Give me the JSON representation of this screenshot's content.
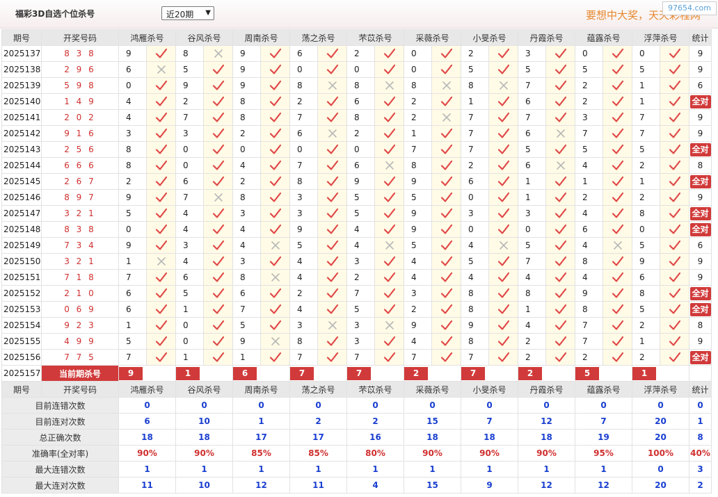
{
  "header": {
    "title": "福彩3D自选个位杀号",
    "period_select": "近20期",
    "slogan": "要想中大奖，天天彩程网",
    "watermark": "97654.com"
  },
  "columns": {
    "qihao": "期号",
    "draw": "开奖号码",
    "experts": [
      "鸿雁杀号",
      "谷风杀号",
      "周南杀号",
      "荡之杀号",
      "芣苡杀号",
      "采薇杀号",
      "小旻杀号",
      "丹霞杀号",
      "蕴露杀号",
      "浮萍杀号"
    ],
    "stat": "统计"
  },
  "rows": [
    {
      "q": "2025137",
      "d": "8 3 8",
      "k": [
        9,
        8,
        9,
        6,
        2,
        0,
        2,
        3,
        0,
        0
      ],
      "r": [
        1,
        0,
        1,
        1,
        1,
        1,
        1,
        1,
        1,
        1
      ],
      "s": "9"
    },
    {
      "q": "2025138",
      "d": "2 9 6",
      "k": [
        6,
        5,
        9,
        0,
        0,
        0,
        5,
        5,
        5,
        5
      ],
      "r": [
        0,
        1,
        1,
        1,
        1,
        1,
        1,
        1,
        1,
        1
      ],
      "s": "9"
    },
    {
      "q": "2025139",
      "d": "5 9 8",
      "k": [
        0,
        9,
        9,
        8,
        8,
        8,
        8,
        7,
        2,
        1
      ],
      "r": [
        1,
        1,
        1,
        0,
        0,
        0,
        0,
        1,
        1,
        1
      ],
      "s": "6"
    },
    {
      "q": "2025140",
      "d": "1 4 9",
      "k": [
        4,
        2,
        8,
        2,
        6,
        2,
        1,
        6,
        2,
        1
      ],
      "r": [
        1,
        1,
        1,
        1,
        1,
        1,
        1,
        1,
        1,
        1
      ],
      "s": "全对"
    },
    {
      "q": "2025141",
      "d": "2 0 2",
      "k": [
        4,
        7,
        8,
        7,
        8,
        2,
        7,
        7,
        3,
        7
      ],
      "r": [
        1,
        1,
        1,
        1,
        1,
        0,
        1,
        1,
        1,
        1
      ],
      "s": "9"
    },
    {
      "q": "2025142",
      "d": "9 1 6",
      "k": [
        3,
        3,
        2,
        6,
        2,
        1,
        7,
        6,
        7,
        7
      ],
      "r": [
        1,
        1,
        1,
        0,
        1,
        1,
        1,
        0,
        1,
        1
      ],
      "s": "9"
    },
    {
      "q": "2025143",
      "d": "2 5 6",
      "k": [
        8,
        0,
        0,
        0,
        0,
        7,
        7,
        5,
        5,
        5
      ],
      "r": [
        1,
        1,
        1,
        1,
        1,
        1,
        1,
        1,
        1,
        1
      ],
      "s": "全对"
    },
    {
      "q": "2025144",
      "d": "6 6 6",
      "k": [
        8,
        0,
        4,
        7,
        6,
        8,
        2,
        6,
        4,
        2
      ],
      "r": [
        1,
        1,
        1,
        1,
        0,
        1,
        1,
        0,
        1,
        1
      ],
      "s": "8"
    },
    {
      "q": "2025145",
      "d": "2 6 7",
      "k": [
        2,
        6,
        2,
        8,
        9,
        9,
        6,
        1,
        1,
        1
      ],
      "r": [
        1,
        1,
        1,
        1,
        1,
        1,
        1,
        1,
        1,
        1
      ],
      "s": "全对"
    },
    {
      "q": "2025146",
      "d": "8 9 7",
      "k": [
        9,
        7,
        8,
        3,
        5,
        5,
        0,
        1,
        2,
        2
      ],
      "r": [
        1,
        0,
        1,
        1,
        1,
        1,
        1,
        1,
        1,
        1
      ],
      "s": "9"
    },
    {
      "q": "2025147",
      "d": "3 2 1",
      "k": [
        5,
        4,
        3,
        3,
        5,
        9,
        3,
        3,
        4,
        8
      ],
      "r": [
        1,
        1,
        1,
        1,
        1,
        1,
        1,
        1,
        1,
        1
      ],
      "s": "全对"
    },
    {
      "q": "2025148",
      "d": "8 3 8",
      "k": [
        0,
        4,
        4,
        9,
        4,
        9,
        0,
        0,
        6,
        0
      ],
      "r": [
        1,
        1,
        1,
        1,
        1,
        1,
        1,
        1,
        1,
        1
      ],
      "s": "全对"
    },
    {
      "q": "2025149",
      "d": "7 3 4",
      "k": [
        9,
        3,
        4,
        5,
        4,
        5,
        4,
        5,
        4,
        5
      ],
      "r": [
        1,
        1,
        0,
        1,
        0,
        1,
        0,
        1,
        0,
        1
      ],
      "s": "6"
    },
    {
      "q": "2025150",
      "d": "3 2 1",
      "k": [
        1,
        4,
        3,
        4,
        3,
        4,
        5,
        7,
        8,
        9
      ],
      "r": [
        0,
        1,
        1,
        1,
        1,
        1,
        1,
        1,
        1,
        1
      ],
      "s": "9"
    },
    {
      "q": "2025151",
      "d": "7 1 8",
      "k": [
        7,
        6,
        8,
        4,
        2,
        4,
        4,
        4,
        4,
        6
      ],
      "r": [
        1,
        1,
        0,
        1,
        1,
        1,
        1,
        1,
        1,
        1
      ],
      "s": "9"
    },
    {
      "q": "2025152",
      "d": "2 1 0",
      "k": [
        6,
        5,
        6,
        2,
        7,
        3,
        8,
        8,
        9,
        8
      ],
      "r": [
        1,
        1,
        1,
        1,
        1,
        1,
        1,
        1,
        1,
        1
      ],
      "s": "全对"
    },
    {
      "q": "2025153",
      "d": "0 6 9",
      "k": [
        6,
        1,
        7,
        4,
        5,
        2,
        8,
        1,
        8,
        5
      ],
      "r": [
        1,
        1,
        1,
        1,
        1,
        1,
        1,
        1,
        1,
        1
      ],
      "s": "全对"
    },
    {
      "q": "2025154",
      "d": "9 2 3",
      "k": [
        1,
        0,
        5,
        3,
        3,
        9,
        9,
        4,
        7,
        2
      ],
      "r": [
        1,
        1,
        1,
        0,
        0,
        1,
        1,
        1,
        1,
        1
      ],
      "s": "8"
    },
    {
      "q": "2025155",
      "d": "4 9 9",
      "k": [
        5,
        0,
        9,
        8,
        3,
        4,
        8,
        2,
        7,
        1
      ],
      "r": [
        1,
        1,
        0,
        1,
        1,
        1,
        1,
        1,
        1,
        1
      ],
      "s": "9"
    },
    {
      "q": "2025156",
      "d": "7 7 5",
      "k": [
        7,
        1,
        1,
        7,
        7,
        7,
        7,
        2,
        2,
        2
      ],
      "r": [
        1,
        1,
        1,
        1,
        1,
        1,
        1,
        1,
        1,
        1
      ],
      "s": "全对"
    }
  ],
  "current": {
    "q": "2025157",
    "label": "当前期杀号",
    "k": [
      9,
      1,
      6,
      7,
      7,
      2,
      7,
      2,
      5,
      1
    ]
  },
  "stats": [
    {
      "label": "目前连错次数",
      "v": [
        "0",
        "0",
        "0",
        "0",
        "0",
        "0",
        "0",
        "0",
        "0",
        "0"
      ],
      "s": "0"
    },
    {
      "label": "目前连对次数",
      "v": [
        "6",
        "10",
        "1",
        "2",
        "2",
        "15",
        "7",
        "12",
        "7",
        "20"
      ],
      "s": "1"
    },
    {
      "label": "总正确次数",
      "v": [
        "18",
        "18",
        "17",
        "17",
        "16",
        "18",
        "18",
        "18",
        "19",
        "20"
      ],
      "s": "8"
    },
    {
      "label": "准确率(全对率)",
      "v": [
        "90%",
        "90%",
        "85%",
        "85%",
        "80%",
        "90%",
        "90%",
        "90%",
        "95%",
        "100%"
      ],
      "s": "40%",
      "red": true
    },
    {
      "label": "最大连错次数",
      "v": [
        "1",
        "1",
        "1",
        "1",
        "1",
        "1",
        "1",
        "1",
        "1",
        "0"
      ],
      "s": "3"
    },
    {
      "label": "最大连对次数",
      "v": [
        "11",
        "10",
        "12",
        "11",
        "4",
        "15",
        "9",
        "12",
        "12",
        "20"
      ],
      "s": "2"
    }
  ],
  "colors": {
    "accent": "#d13a3a",
    "stat_blue": "#1a3fd0",
    "check": "#e04848",
    "cross": "#b8b8b8",
    "mark_bg": "#fffbe6"
  }
}
